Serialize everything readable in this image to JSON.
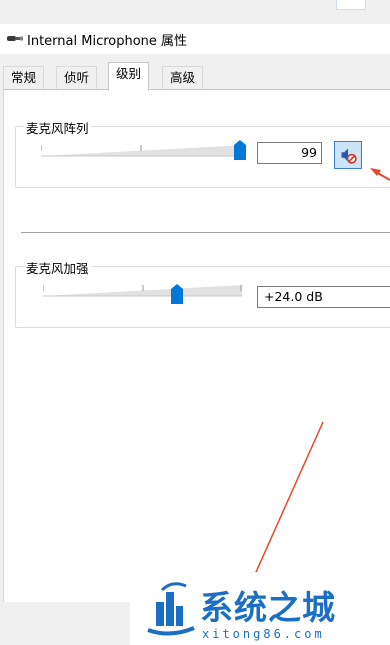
{
  "window": {
    "title": "Internal Microphone 属性"
  },
  "tabs": [
    {
      "label": "常规",
      "active": false
    },
    {
      "label": "侦听",
      "active": false
    },
    {
      "label": "级别",
      "active": true
    },
    {
      "label": "高级",
      "active": false
    }
  ],
  "mic_array": {
    "label": "麦克风阵列",
    "value": "99",
    "level": 0.99,
    "mute_icon": "speaker-muted-icon"
  },
  "mic_boost": {
    "label": "麦克风加强",
    "value": "+24.0 dB",
    "level": 0.66
  },
  "watermark": {
    "title": "系统之城",
    "url": "xitong86.com"
  },
  "colors": {
    "accent": "#1a6fc4",
    "slider_thumb": "#0078d7",
    "annotation_arrow": "#e8472c",
    "mute_button_bg": "#cce4f7"
  }
}
